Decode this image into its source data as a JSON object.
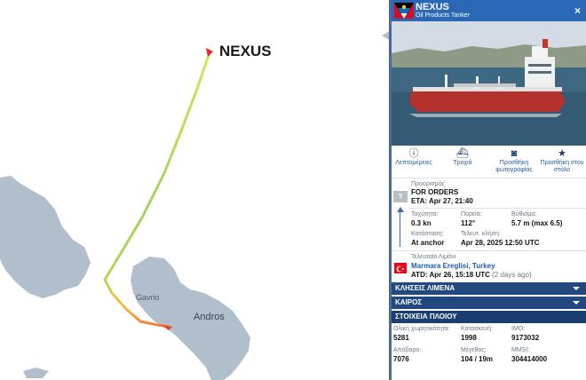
{
  "map": {
    "vessel_label": "NEXUS",
    "places": {
      "gavrio": "Gavrio",
      "andros": "Andros"
    }
  },
  "panel": {
    "title": "NEXUS",
    "subtitle": "Oil Products Tanker",
    "close_icon": "×",
    "actions": [
      {
        "label": "Λεπτομέρειες",
        "icon": "info-icon"
      },
      {
        "label": "Τροχιά",
        "icon": "ship-track-icon"
      },
      {
        "label": "Προσθήκη φωτογραφίας",
        "icon": "camera-icon"
      },
      {
        "label": "Προσθήκη στον στόλο",
        "icon": "star-icon"
      }
    ],
    "destination": {
      "label": "Προορισμός",
      "value": "FOR ORDERS",
      "eta": "ETA: Apr 27, 21:40"
    },
    "unknown_badge": "?",
    "speed": {
      "label": "Ταχύτητα:",
      "value": "0.3 kn"
    },
    "course": {
      "label": "Πορεία:",
      "value": "112°"
    },
    "draught": {
      "label": "Βύθισμα:",
      "value": "5.7 m (max 6.5)"
    },
    "status": {
      "label": "Κατάσταση:",
      "value": "At anchor"
    },
    "last_report": {
      "label": "Τελευτ. κλήση:",
      "value": "Apr 28, 2025 12:50 UTC"
    },
    "last_port": {
      "label": "Τελευταίο Λιμάνι",
      "name": "Marmara Ereglisi, Turkey",
      "atd": "ATD: Apr 26, 15:18 UTC",
      "ago": "(2 days ago)"
    },
    "sections": [
      "ΚΛΗΣΕΙΣ ΛΙΜΕΝΑ",
      "ΚΑΙΡΟΣ",
      "ΣΤΟΙΧΕΙΑ ΠΛΟΙΟΥ"
    ],
    "ship_info": {
      "gt": {
        "label": "Ολική χωρητικότητα:",
        "value": "5281"
      },
      "built": {
        "label": "Κατασκευή:",
        "value": "1998"
      },
      "imo": {
        "label": "IMO:",
        "value": "9173032"
      },
      "dwt": {
        "label": "Απόβαρο:",
        "value": "7076"
      },
      "size": {
        "label": "Μέγεθος:",
        "value": "104 / 19m"
      },
      "mmsi": {
        "label": "MMSI:",
        "value": "304414000"
      }
    },
    "colors": {
      "header": "#2a67b5",
      "section_bar": "#21497f",
      "link": "#1f5fa8"
    }
  }
}
